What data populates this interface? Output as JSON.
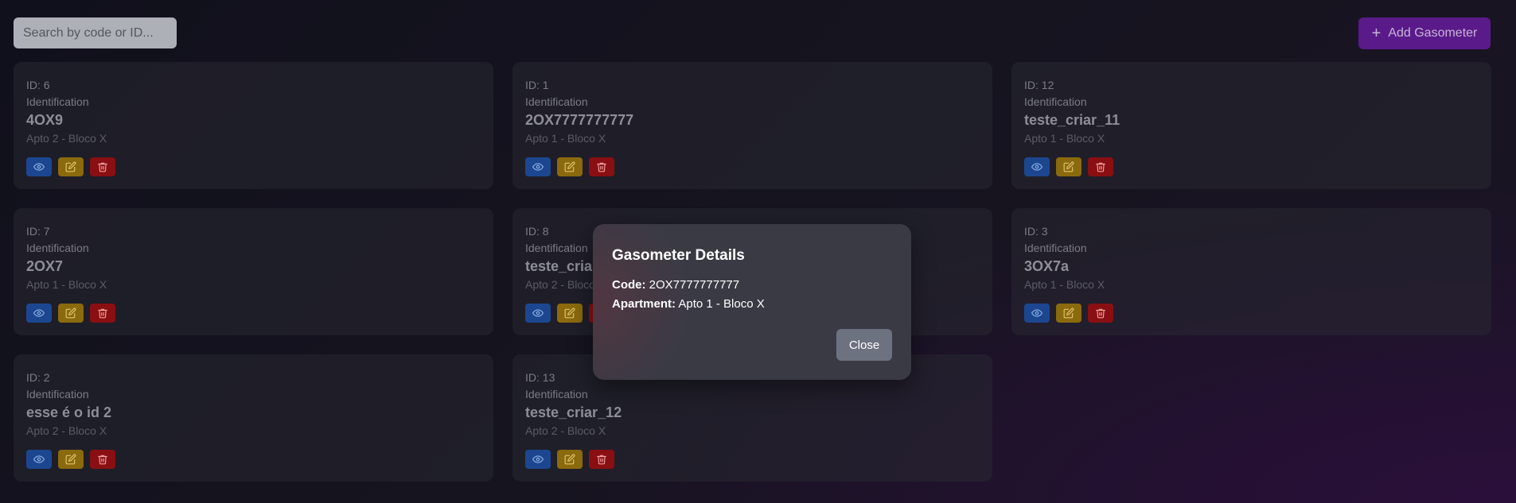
{
  "search": {
    "placeholder": "Search by code or ID..."
  },
  "header": {
    "add_label": "Add Gasometer",
    "add_icon": "plus-icon"
  },
  "cards": [
    {
      "id": "ID: 6",
      "ident_label": "Identification",
      "code": "4OX9",
      "apartment": "Apto 2 - Bloco X"
    },
    {
      "id": "ID: 1",
      "ident_label": "Identification",
      "code": "2OX7777777777",
      "apartment": "Apto 1 - Bloco X"
    },
    {
      "id": "ID: 12",
      "ident_label": "Identification",
      "code": "teste_criar_11",
      "apartment": "Apto 1 - Bloco X"
    },
    {
      "id": "ID: 7",
      "ident_label": "Identification",
      "code": "2OX7",
      "apartment": "Apto 1 - Bloco X"
    },
    {
      "id": "ID: 8",
      "ident_label": "Identification",
      "code": "teste_criar",
      "apartment": "Apto 2 - Bloco"
    },
    {
      "id": "ID: 3",
      "ident_label": "Identification",
      "code": "3OX7a",
      "apartment": "Apto 1 - Bloco X"
    },
    {
      "id": "ID: 2",
      "ident_label": "Identification",
      "code": "esse é o id 2",
      "apartment": "Apto 2 - Bloco X"
    },
    {
      "id": "ID: 13",
      "ident_label": "Identification",
      "code": "teste_criar_12",
      "apartment": "Apto 2 - Bloco X"
    }
  ],
  "actions": {
    "view_icon": "eye-icon",
    "edit_icon": "edit-icon",
    "delete_icon": "trash-icon"
  },
  "modal": {
    "title": "Gasometer Details",
    "code_label": "Code:",
    "code_value": "2OX7777777777",
    "apartment_label": "Apartment:",
    "apartment_value": "Apto 1 - Bloco X",
    "close_label": "Close"
  },
  "colors": {
    "accent": "#5b1a8a",
    "view": "#1c4790",
    "edit": "#8a6a0d",
    "delete": "#8a0f12"
  }
}
